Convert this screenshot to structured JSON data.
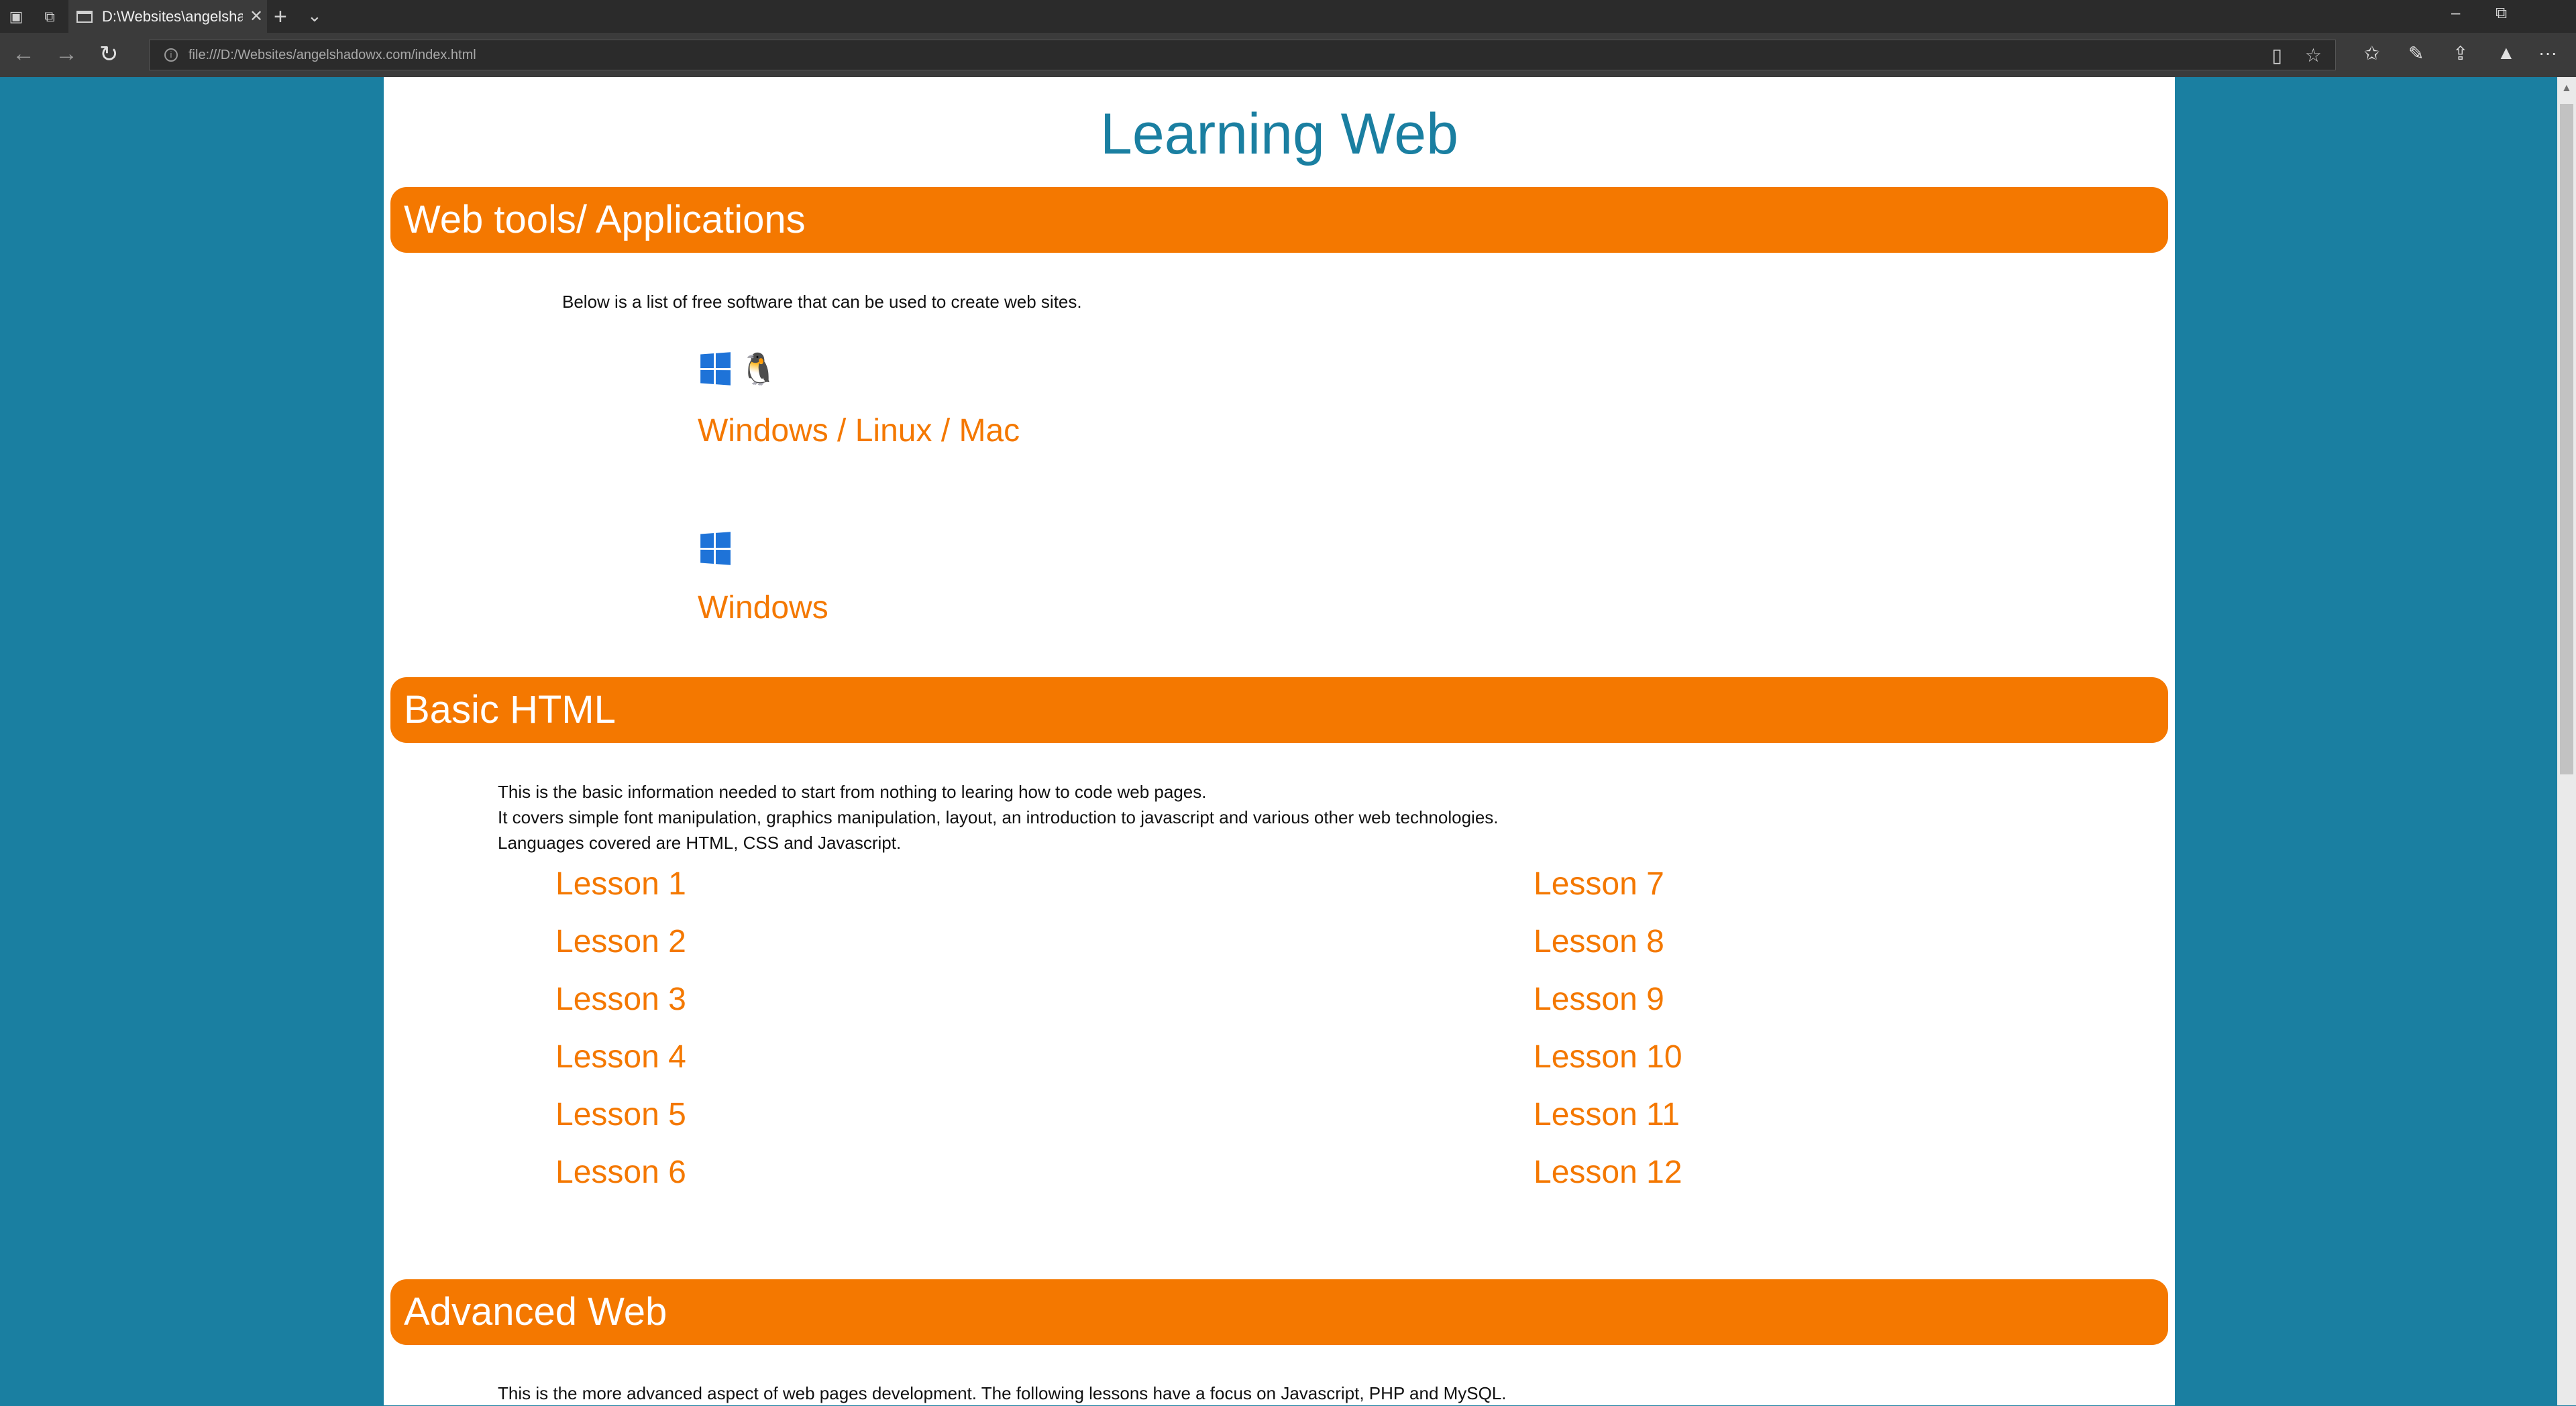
{
  "browser": {
    "tab_title": "D:\\Websites\\angelshad…",
    "tab_close": "✕",
    "new_tab": "+",
    "tab_menu": "⌄",
    "url": "file:///D:/Websites/angelshadowx.com/index.html",
    "win_min": "–",
    "win_restore": "⧉",
    "back": "←",
    "forward": "→",
    "refresh": "↻",
    "more": "···"
  },
  "page": {
    "title": "Learning Web",
    "sections": {
      "tools": {
        "heading": "Web tools/ Applications",
        "intro": "Below is a list of free software that can be used to create web sites.",
        "cross_platform_link": "Windows / Linux / Mac",
        "windows_link": "Windows"
      },
      "basic": {
        "heading": "Basic HTML",
        "line1": "This is the basic information needed to start from nothing to learing how to code web pages.",
        "line2": "It covers simple font manipulation, graphics manipulation, layout, an introduction to javascript and various other web technologies.",
        "line3": "Languages covered are HTML, CSS and Javascript.",
        "lessons_left": [
          "Lesson 1",
          "Lesson 2",
          "Lesson 3",
          "Lesson 4",
          "Lesson 5",
          "Lesson 6"
        ],
        "lessons_right": [
          "Lesson 7",
          "Lesson 8",
          "Lesson 9",
          "Lesson 10",
          "Lesson 11",
          "Lesson 12"
        ]
      },
      "advanced": {
        "heading": "Advanced Web",
        "intro": "This is the more advanced aspect of web pages development. The following lessons have a focus on Javascript, PHP and MySQL."
      }
    }
  },
  "colors": {
    "accent_orange": "#f47800",
    "page_blue": "#1a7fa1",
    "windows_blue": "#1e73d8"
  },
  "icons": [
    "windows-icon",
    "linux-tux-icon",
    "apple-icon"
  ]
}
